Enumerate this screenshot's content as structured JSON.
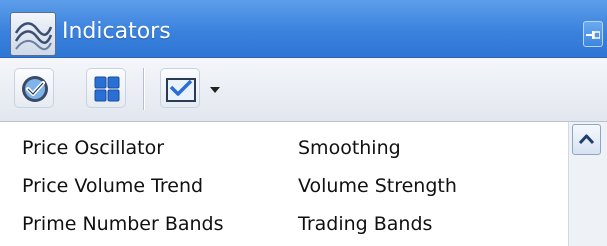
{
  "window": {
    "title": "Indicators",
    "icon": "indicator-chart-icon"
  },
  "titlebar": {
    "pin_icon": "pin-icon"
  },
  "toolbar": {
    "buttons": [
      {
        "icon": "check-circle-icon"
      },
      {
        "icon": "grid-icon"
      },
      {
        "icon": "check-chart-icon",
        "has_dropdown": true
      }
    ]
  },
  "list": {
    "rows": [
      {
        "col1": "Price Oscillator",
        "col2": "Smoothing"
      },
      {
        "col1": "Price Volume Trend",
        "col2": "Volume Strength"
      },
      {
        "col1": "Prime Number Bands",
        "col2": "Trading Bands"
      }
    ]
  },
  "colors": {
    "titlebar": "#3a82de",
    "title_text": "#ffffff",
    "grid_icon": "#2a6fd6"
  }
}
